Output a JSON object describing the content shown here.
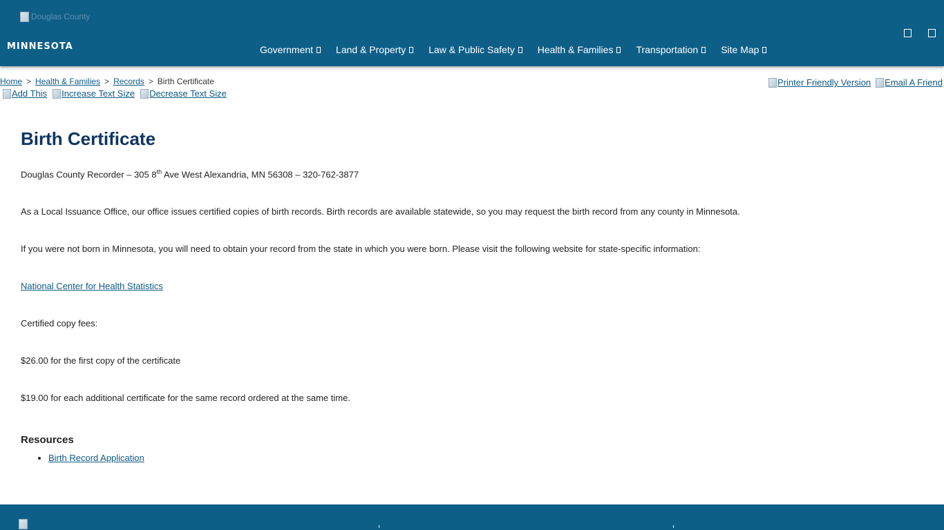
{
  "header": {
    "logo_alt": "Douglas County",
    "logo_text": "MINNESOTA",
    "nav": [
      {
        "label": "Government"
      },
      {
        "label": "Land & Property"
      },
      {
        "label": "Law & Public Safety"
      },
      {
        "label": "Health & Families"
      },
      {
        "label": "Transportation"
      },
      {
        "label": "Site Map"
      }
    ]
  },
  "breadcrumb": {
    "items": [
      "Home",
      "Health & Families",
      "Records"
    ],
    "current": "Birth Certificate",
    "separator": ">"
  },
  "tools": {
    "add_this": "Add This",
    "increase_text": "Increase Text Size",
    "decrease_text": "Decrease Text Size",
    "printer_friendly": "Printer Friendly Version",
    "email_friend": "Email A Friend"
  },
  "content": {
    "title": "Birth Certificate",
    "address_pre": "Douglas County Recorder – 305 8",
    "address_sup": "th",
    "address_post": " Ave West Alexandria, MN 56308 – 320-762-3877",
    "para_issuance": "As a Local Issuance Office, our office issues certified copies of birth records.  Birth records are available statewide, so you may request the birth record from any county in Minnesota.",
    "para_not_born": "If you were not born in Minnesota, you will need to obtain your record from the state in which you were born.  Please visit the following website for state-specific information:",
    "nchs_link": "National Center for Health Statistics",
    "fees_label": "Certified copy fees:",
    "fee_first": "$26.00 for the first copy of the certificate",
    "fee_additional": "$19.00 for each additional certificate for the same record ordered at the same time.",
    "resources_title": "Resources",
    "resources": [
      "Birth Record Application"
    ]
  },
  "colors": {
    "header_bg": "#0e5f88",
    "title": "#0f3560",
    "link": "#0e5a85"
  }
}
